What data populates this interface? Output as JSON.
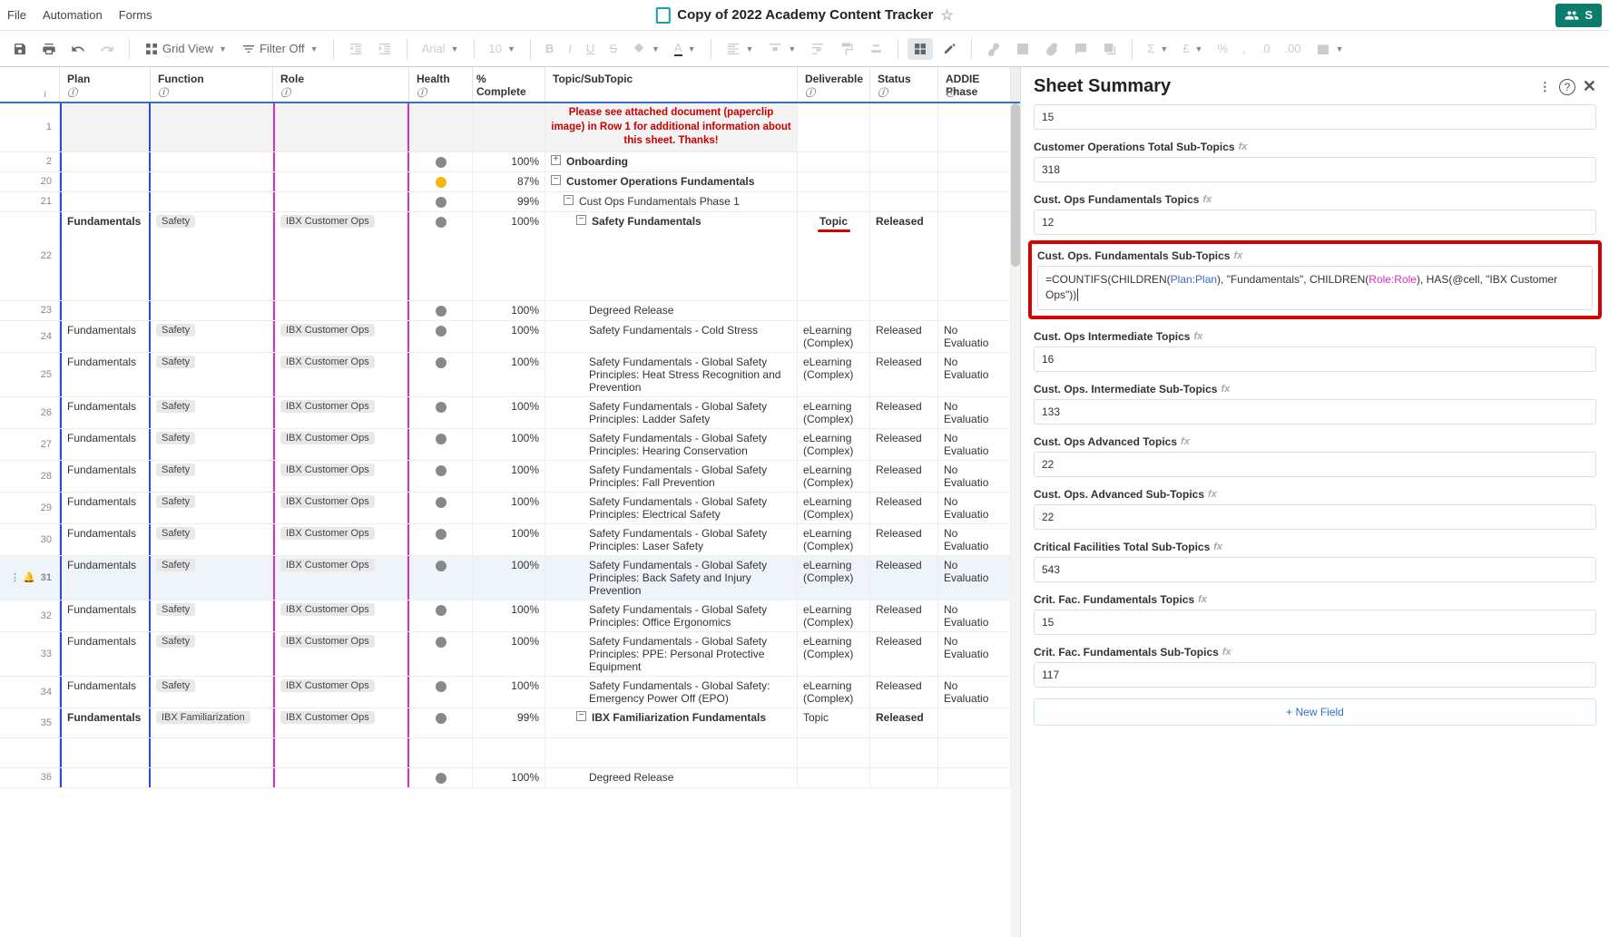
{
  "menubar": {
    "items": [
      "File",
      "Automation",
      "Forms"
    ],
    "title": "Copy of 2022 Academy Content Tracker",
    "share_label": "S"
  },
  "toolbar": {
    "grid_view": "Grid View",
    "filter": "Filter Off",
    "font": "Arial",
    "font_size": "10"
  },
  "columns": {
    "plan": "Plan",
    "function": "Function",
    "role": "Role",
    "health": "Health",
    "complete": "% Complete",
    "topic": "Topic/SubTopic",
    "deliverable": "Deliverable",
    "status": "Status",
    "addie": "ADDIE Phase"
  },
  "rows": [
    {
      "num": "1",
      "topic_note": "Please see attached document (paperclip image) in Row 1 for additional information about this sheet. Thanks!",
      "tall": "taller"
    },
    {
      "num": "2",
      "health": "gray",
      "complete": "100%",
      "toggle": "+",
      "topic": "Onboarding",
      "bold": true
    },
    {
      "num": "20",
      "health": "yellow",
      "complete": "87%",
      "toggle": "-",
      "topic": "Customer Operations Fundamentals",
      "bold": true
    },
    {
      "num": "21",
      "health": "gray",
      "complete": "99%",
      "toggle": "-",
      "indent": 1,
      "topic": "Cust Ops Fundamentals Phase 1"
    },
    {
      "num": "22",
      "plan": "Fundamentals",
      "planbold": true,
      "function": "Safety",
      "role": "IBX Customer Ops",
      "health": "gray",
      "complete": "100%",
      "toggle": "-",
      "indent": 2,
      "topic": "Safety Fundamentals",
      "bold": true,
      "deliverable": "Topic",
      "delivcenter": true,
      "redunder": true,
      "status": "Released",
      "tall": "verytall"
    },
    {
      "num": "23",
      "health": "gray",
      "complete": "100%",
      "indent": 3,
      "topic": "Degreed Release"
    },
    {
      "num": "24",
      "plan": "Fundamentals",
      "function": "Safety",
      "role": "IBX Customer Ops",
      "health": "gray",
      "complete": "100%",
      "indent": 3,
      "topic": "Safety Fundamentals - Cold Stress",
      "deliverable": "eLearning (Complex)",
      "status": "Released",
      "addie": "No Evaluatio",
      "tall": "tall"
    },
    {
      "num": "25",
      "plan": "Fundamentals",
      "function": "Safety",
      "role": "IBX Customer Ops",
      "health": "gray",
      "complete": "100%",
      "indent": 3,
      "topic": "Safety Fundamentals - Global Safety Principles: Heat Stress Recognition and Prevention",
      "deliverable": "eLearning (Complex)",
      "status": "Released",
      "addie": "No Evaluatio",
      "tall": "taller"
    },
    {
      "num": "26",
      "plan": "Fundamentals",
      "function": "Safety",
      "role": "IBX Customer Ops",
      "health": "gray",
      "complete": "100%",
      "indent": 3,
      "topic": "Safety Fundamentals - Global Safety Principles: Ladder Safety",
      "deliverable": "eLearning (Complex)",
      "status": "Released",
      "addie": "No Evaluatio",
      "tall": "tall"
    },
    {
      "num": "27",
      "plan": "Fundamentals",
      "function": "Safety",
      "role": "IBX Customer Ops",
      "health": "gray",
      "complete": "100%",
      "indent": 3,
      "topic": "Safety Fundamentals - Global Safety Principles: Hearing Conservation",
      "deliverable": "eLearning (Complex)",
      "status": "Released",
      "addie": "No Evaluatio",
      "tall": "tall"
    },
    {
      "num": "28",
      "plan": "Fundamentals",
      "function": "Safety",
      "role": "IBX Customer Ops",
      "health": "gray",
      "complete": "100%",
      "indent": 3,
      "topic": "Safety Fundamentals - Global Safety Principles: Fall Prevention",
      "deliverable": "eLearning (Complex)",
      "status": "Released",
      "addie": "No Evaluatio",
      "tall": "tall"
    },
    {
      "num": "29",
      "plan": "Fundamentals",
      "function": "Safety",
      "role": "IBX Customer Ops",
      "health": "gray",
      "complete": "100%",
      "indent": 3,
      "topic": "Safety Fundamentals - Global Safety Principles: Electrical Safety",
      "deliverable": "eLearning (Complex)",
      "status": "Released",
      "addie": "No Evaluatio",
      "tall": "tall"
    },
    {
      "num": "30",
      "plan": "Fundamentals",
      "function": "Safety",
      "role": "IBX Customer Ops",
      "health": "gray",
      "complete": "100%",
      "indent": 3,
      "topic": "Safety Fundamentals - Global Safety Principles: Laser Safety",
      "deliverable": "eLearning (Complex)",
      "status": "Released",
      "addie": "No Evaluatio",
      "tall": "tall"
    },
    {
      "num": "31",
      "hover": true,
      "plan": "Fundamentals",
      "function": "Safety",
      "role": "IBX Customer Ops",
      "health": "gray",
      "complete": "100%",
      "indent": 3,
      "topic": "Safety Fundamentals - Global Safety Principles: Back Safety and Injury Prevention",
      "deliverable": "eLearning (Complex)",
      "status": "Released",
      "addie": "No Evaluatio",
      "tall": "tall",
      "rowicons": true
    },
    {
      "num": "32",
      "plan": "Fundamentals",
      "function": "Safety",
      "role": "IBX Customer Ops",
      "health": "gray",
      "complete": "100%",
      "indent": 3,
      "topic": "Safety Fundamentals - Global Safety Principles: Office Ergonomics",
      "deliverable": "eLearning (Complex)",
      "status": "Released",
      "addie": "No Evaluatio",
      "tall": "tall"
    },
    {
      "num": "33",
      "plan": "Fundamentals",
      "function": "Safety",
      "role": "IBX Customer Ops",
      "health": "gray",
      "complete": "100%",
      "indent": 3,
      "topic": "Safety Fundamentals - Global Safety Principles: PPE: Personal Protective Equipment",
      "deliverable": "eLearning (Complex)",
      "status": "Released",
      "addie": "No Evaluatio",
      "tall": "taller"
    },
    {
      "num": "34",
      "plan": "Fundamentals",
      "function": "Safety",
      "role": "IBX Customer Ops",
      "health": "gray",
      "complete": "100%",
      "indent": 3,
      "topic": "Safety Fundamentals - Global Safety: Emergency Power Off (EPO)",
      "deliverable": "eLearning (Complex)",
      "status": "Released",
      "addie": "No Evaluatio",
      "tall": "tall"
    },
    {
      "num": "35",
      "plan": "Fundamentals",
      "planbold": true,
      "function": "IBX Familiarization",
      "role": "IBX Customer Ops",
      "health": "gray",
      "complete": "99%",
      "toggle": "-",
      "indent": 2,
      "topic": "IBX Familiarization Fundamentals",
      "bold": true,
      "deliverable": "Topic",
      "status": "Released",
      "tall": "tall"
    },
    {
      "num": "",
      "tall": "tall"
    },
    {
      "num": "36",
      "health": "gray",
      "complete": "100%",
      "indent": 3,
      "topic": "Degreed Release"
    }
  ],
  "summary": {
    "title": "Sheet Summary",
    "field0_value": "15",
    "fields": [
      {
        "label": "Customer Operations Total Sub-Topics",
        "value": "318"
      },
      {
        "label": "Cust. Ops Fundamentals Topics",
        "value": "12"
      },
      {
        "label": "Cust. Ops. Fundamentals Sub-Topics",
        "formula_pre": "=COUNTIFS(CHILDREN(",
        "formula_plan": "Plan:Plan",
        "formula_mid": "), \"Fundamentals\", CHILDREN(",
        "formula_role": "Role:Role",
        "formula_post": "), HAS(@cell, \"IBX Customer Ops\"))",
        "highlight": true
      },
      {
        "label": "Cust. Ops Intermediate Topics",
        "value": "16"
      },
      {
        "label": "Cust. Ops. Intermediate Sub-Topics",
        "value": "133"
      },
      {
        "label": "Cust. Ops Advanced Topics",
        "value": "22"
      },
      {
        "label": "Cust. Ops. Advanced Sub-Topics",
        "value": "22"
      },
      {
        "label": "Critical Facilities Total Sub-Topics",
        "value": "543"
      },
      {
        "label": "Crit. Fac. Fundamentals Topics",
        "value": "15"
      },
      {
        "label": "Crit. Fac. Fundamentals Sub-Topics",
        "value": "117"
      }
    ],
    "new_field": "+ New Field"
  }
}
